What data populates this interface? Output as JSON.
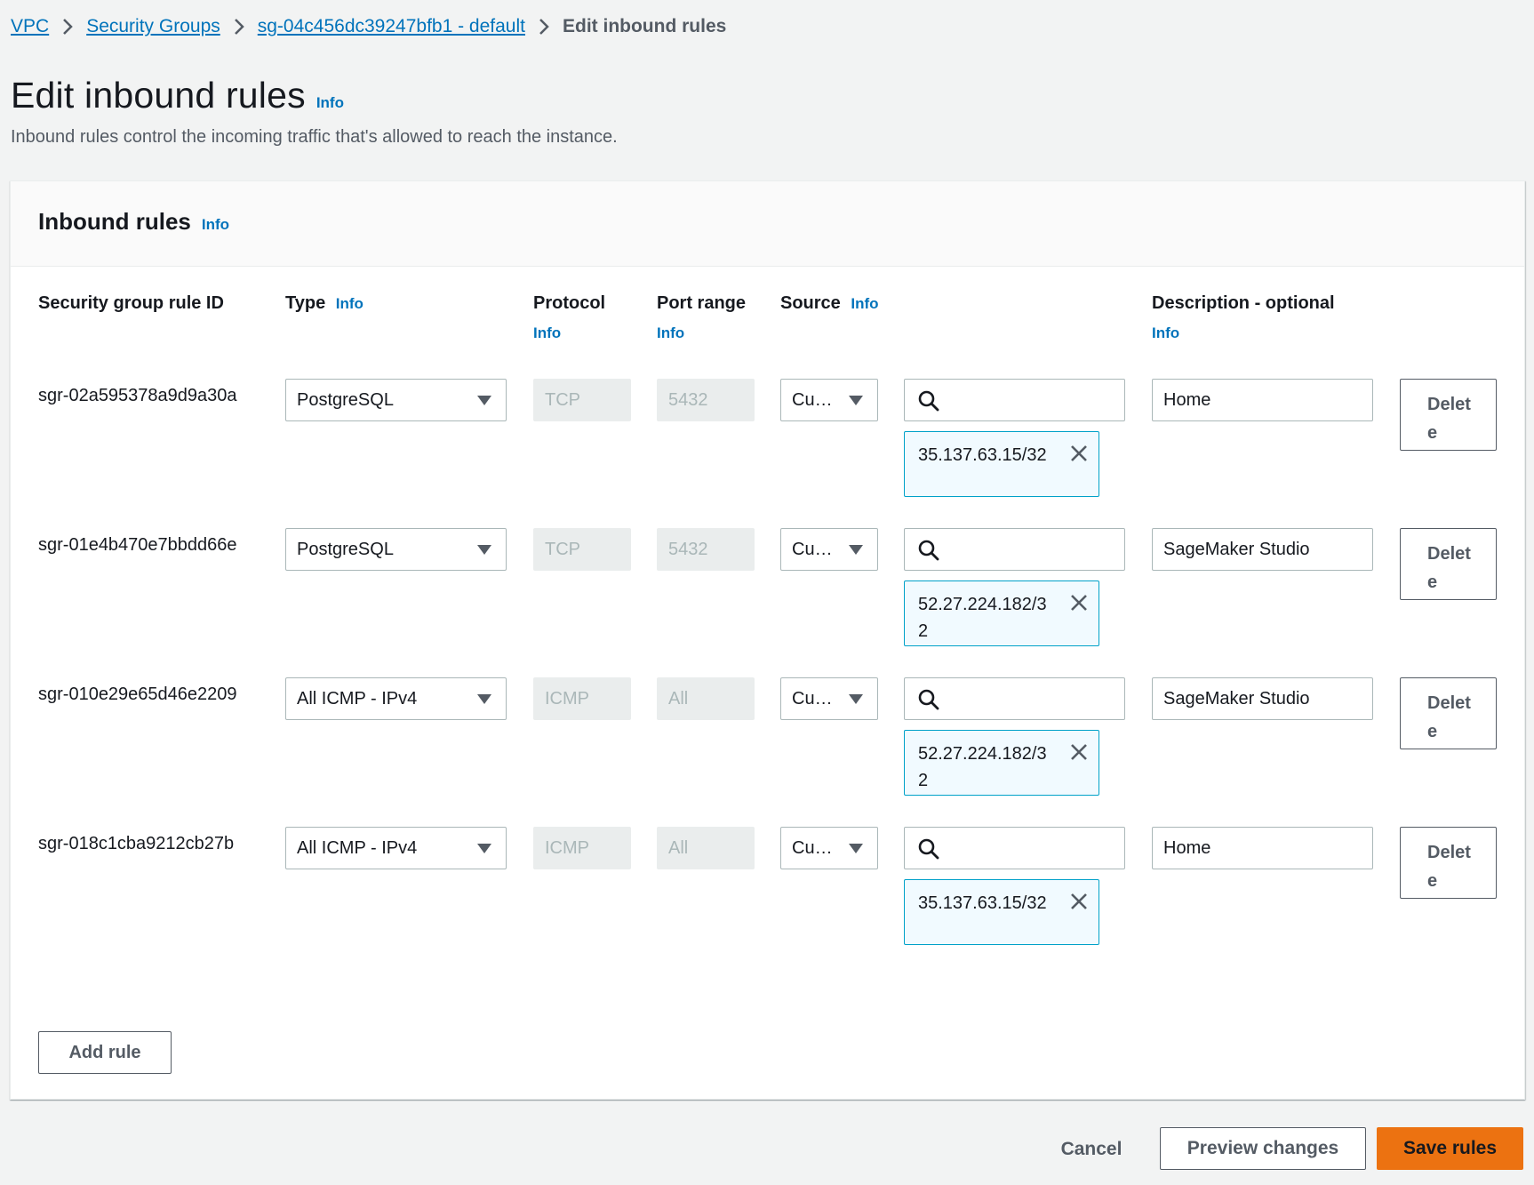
{
  "breadcrumb": {
    "items": [
      "VPC",
      "Security Groups",
      "sg-04c456dc39247bfb1 - default"
    ],
    "current": "Edit inbound rules"
  },
  "page": {
    "title": "Edit inbound rules",
    "info": "Info",
    "description": "Inbound rules control the incoming traffic that's allowed to reach the instance."
  },
  "section": {
    "title": "Inbound rules",
    "info": "Info"
  },
  "columns": {
    "rule_id": "Security group rule ID",
    "type": "Type",
    "protocol": "Protocol",
    "port_range": "Port range",
    "source": "Source",
    "description": "Description - optional",
    "info": "Info"
  },
  "rules": [
    {
      "id": "sgr-02a595378a9d9a30a",
      "type": "PostgreSQL",
      "protocol": "TCP",
      "port": "5432",
      "source_type": "Cu…",
      "cidr": "35.137.63.15/32",
      "description": "Home",
      "delete_label": "Delete"
    },
    {
      "id": "sgr-01e4b470e7bbdd66e",
      "type": "PostgreSQL",
      "protocol": "TCP",
      "port": "5432",
      "source_type": "Cu…",
      "cidr": "52.27.224.182/32",
      "description": "SageMaker Studio",
      "delete_label": "Delete"
    },
    {
      "id": "sgr-010e29e65d46e2209",
      "type": "All ICMP - IPv4",
      "protocol": "ICMP",
      "port": "All",
      "source_type": "Cu…",
      "cidr": "52.27.224.182/32",
      "description": "SageMaker Studio",
      "delete_label": "Delete"
    },
    {
      "id": "sgr-018c1cba9212cb27b",
      "type": "All ICMP - IPv4",
      "protocol": "ICMP",
      "port": "All",
      "source_type": "Cu…",
      "cidr": "35.137.63.15/32",
      "description": "Home",
      "delete_label": "Delete"
    }
  ],
  "actions": {
    "add_rule": "Add rule",
    "cancel": "Cancel",
    "preview": "Preview changes",
    "save": "Save rules"
  },
  "colors": {
    "link": "#0073bb",
    "primary_button": "#ec7211",
    "token_border": "#00a1c9",
    "token_bg": "#f1faff"
  }
}
